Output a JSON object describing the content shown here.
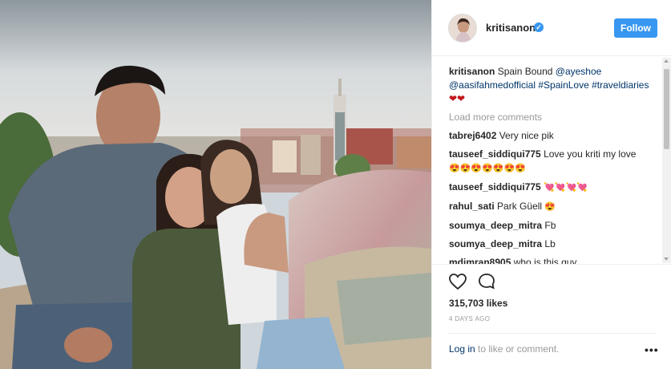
{
  "post": {
    "username": "kritisanon",
    "follow_label": "Follow",
    "verified_mark": "✓",
    "caption": {
      "user": "kritisanon",
      "text": "Spain Bound",
      "mention1": "@ayeshoe",
      "mention2": "@aasifahmedofficial",
      "tag1": "#SpainLove",
      "tag2": "#traveldiaries",
      "emoji": "❤❤"
    },
    "load_more": "Load more comments",
    "comments": [
      {
        "user": "tabrej6402",
        "text": "Very nice pik"
      },
      {
        "user": "tauseef_siddiqui775",
        "text": "Love you kriti my love",
        "emoji": "😍😍😍😍😍😍😍"
      },
      {
        "user": "tauseef_siddiqui775",
        "text": "",
        "emoji": "💘💘💘💘"
      },
      {
        "user": "rahul_sati",
        "text": "Park Güell",
        "emoji": "😍"
      },
      {
        "user": "soumya_deep_mitra",
        "text": "Fb"
      },
      {
        "user": "soumya_deep_mitra",
        "text": "Lb"
      },
      {
        "user": "mdimran8905",
        "text": "who is this guy"
      }
    ],
    "likes": "315,703 likes",
    "time_ago": "4 DAYS AGO",
    "login_link": "Log in",
    "login_rest": " to like or comment.",
    "more_options": "•••",
    "icons": {
      "like": "heart-icon",
      "comment": "comment-icon",
      "options": "more-options-icon"
    }
  }
}
